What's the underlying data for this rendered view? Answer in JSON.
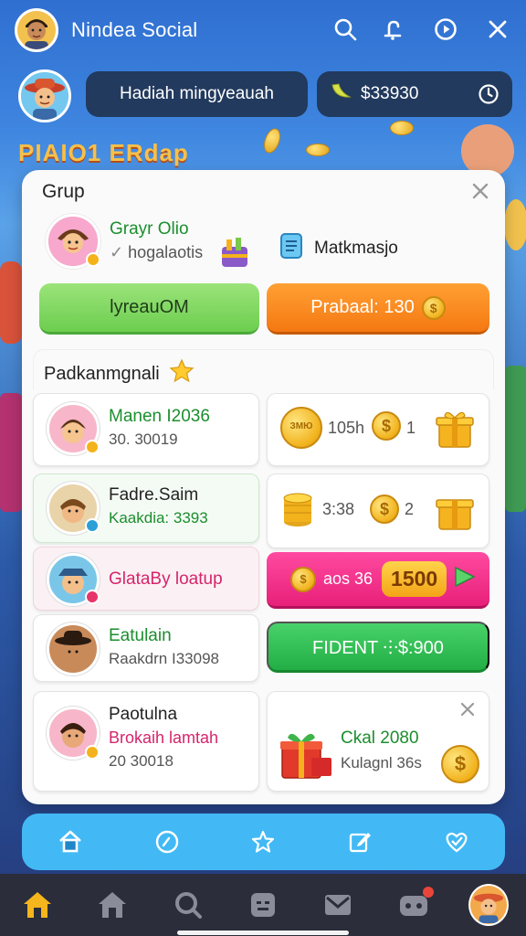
{
  "app": {
    "title": "Nindea Social"
  },
  "header": {
    "reward_label": "Hadiah mingyeauah",
    "coin_balance": "$33930",
    "promo_title": "PIAIO1 ERdap"
  },
  "panel": {
    "title": "Grup",
    "group": {
      "name": "Grayr Olio",
      "subtitle": "hogalaotis"
    },
    "matk_label": "Matkmasjo",
    "btn_green": "lyreauOM",
    "btn_orange": "Prabaal: 130",
    "section_title": "Padkanmgnali"
  },
  "members": [
    {
      "name": "Manen I2036",
      "sub": "30. 30019",
      "name_color": "#1b8e2e",
      "badge": "#f4b31c"
    },
    {
      "name": "Fadre.Saim",
      "sub": "Kaakdia: 3393",
      "name_color": "#222222",
      "sub_color": "#1b8e2e",
      "badge": "#2aa0d8"
    },
    {
      "name": "GlataBy loatup",
      "sub": "",
      "name_color": "#d5256b",
      "badge": "#e6356a"
    },
    {
      "name": "Eatulain",
      "sub": "Raakdrn I33098",
      "name_color": "#1b8e2e",
      "badge": ""
    },
    {
      "name": "Paotulna",
      "sub": "Brokaih lamtah",
      "sub2": "20 30018",
      "name_color": "#222222",
      "sub_color": "#d5256b",
      "badge": "#f4b31c"
    }
  ],
  "rewards": [
    {
      "badge_text": "ЗМЮ",
      "amount": "105h",
      "coin_count": "1"
    },
    {
      "amount": "3:38",
      "coin_count": "2"
    }
  ],
  "pink_button": {
    "label": "aos 36",
    "value": "1500"
  },
  "fident_button": "FIDENT ⸭$:900",
  "gift_card": {
    "title": "Ckal 2080",
    "sub": "Kulagnl 36s"
  },
  "colors": {
    "accent_blue": "#42b9f5",
    "nav_bg": "#2b2d3a",
    "green": "#22ae45",
    "orange": "#f57812",
    "pink": "#e8207a"
  },
  "tabs": [
    "home-icon",
    "compass-icon",
    "star-icon",
    "edit-icon",
    "heart-check-icon"
  ],
  "nav": [
    "home-icon",
    "house-icon",
    "search-icon",
    "chat-icon",
    "mail-icon",
    "game-icon",
    "profile-avatar"
  ]
}
